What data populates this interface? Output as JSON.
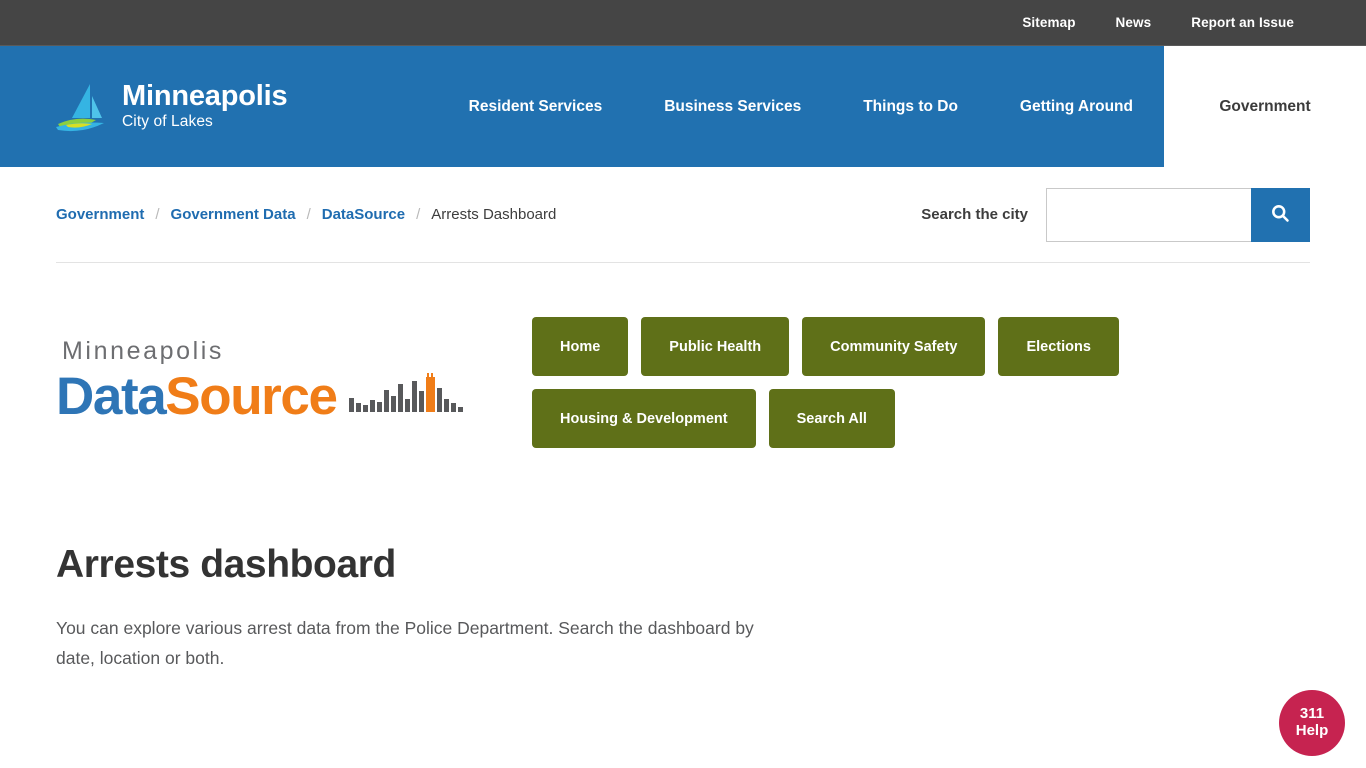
{
  "utility_bar": {
    "links": [
      {
        "label": "Sitemap"
      },
      {
        "label": "News"
      },
      {
        "label": "Report an Issue"
      }
    ]
  },
  "header": {
    "brand": {
      "title": "Minneapolis",
      "subtitle": "City of Lakes",
      "icon": "sailboat-icon"
    },
    "nav": [
      {
        "label": "Resident Services",
        "active": false
      },
      {
        "label": "Business Services",
        "active": false
      },
      {
        "label": "Things to Do",
        "active": false
      },
      {
        "label": "Getting Around",
        "active": false
      },
      {
        "label": "Government",
        "active": true
      }
    ]
  },
  "breadcrumb": {
    "separator": "/",
    "items": [
      {
        "label": "Government",
        "current": false
      },
      {
        "label": "Government Data",
        "current": false
      },
      {
        "label": "DataSource",
        "current": false
      },
      {
        "label": "Arrests Dashboard",
        "current": true
      }
    ]
  },
  "search": {
    "label": "Search the city",
    "value": "",
    "placeholder": "",
    "icon": "search-icon"
  },
  "datasource": {
    "logo": {
      "city": "Minneapolis",
      "word_one": "Data",
      "word_two": "Source",
      "chart_icon": "bar-chart-icon"
    },
    "buttons": [
      {
        "label": "Home"
      },
      {
        "label": "Public Health"
      },
      {
        "label": "Community Safety"
      },
      {
        "label": "Elections"
      },
      {
        "label": "Housing & Development"
      },
      {
        "label": "Search All"
      }
    ]
  },
  "main": {
    "title": "Arrests dashboard",
    "intro": "You can explore various arrest data from the Police Department. Search the dashboard by date, location or both."
  },
  "help_widget": {
    "number": "311",
    "word": "Help"
  },
  "colors": {
    "utility_bar": "#454545",
    "header_blue": "#2171B0",
    "link_blue": "#1f6cb0",
    "button_green": "#5F7018",
    "logo_data_blue": "#2e75b6",
    "logo_source_orange": "#f07d18",
    "logo_city_gray": "#6d6e71",
    "help_badge": "#C62350",
    "body_text": "#58595b",
    "title_text": "#333333"
  }
}
